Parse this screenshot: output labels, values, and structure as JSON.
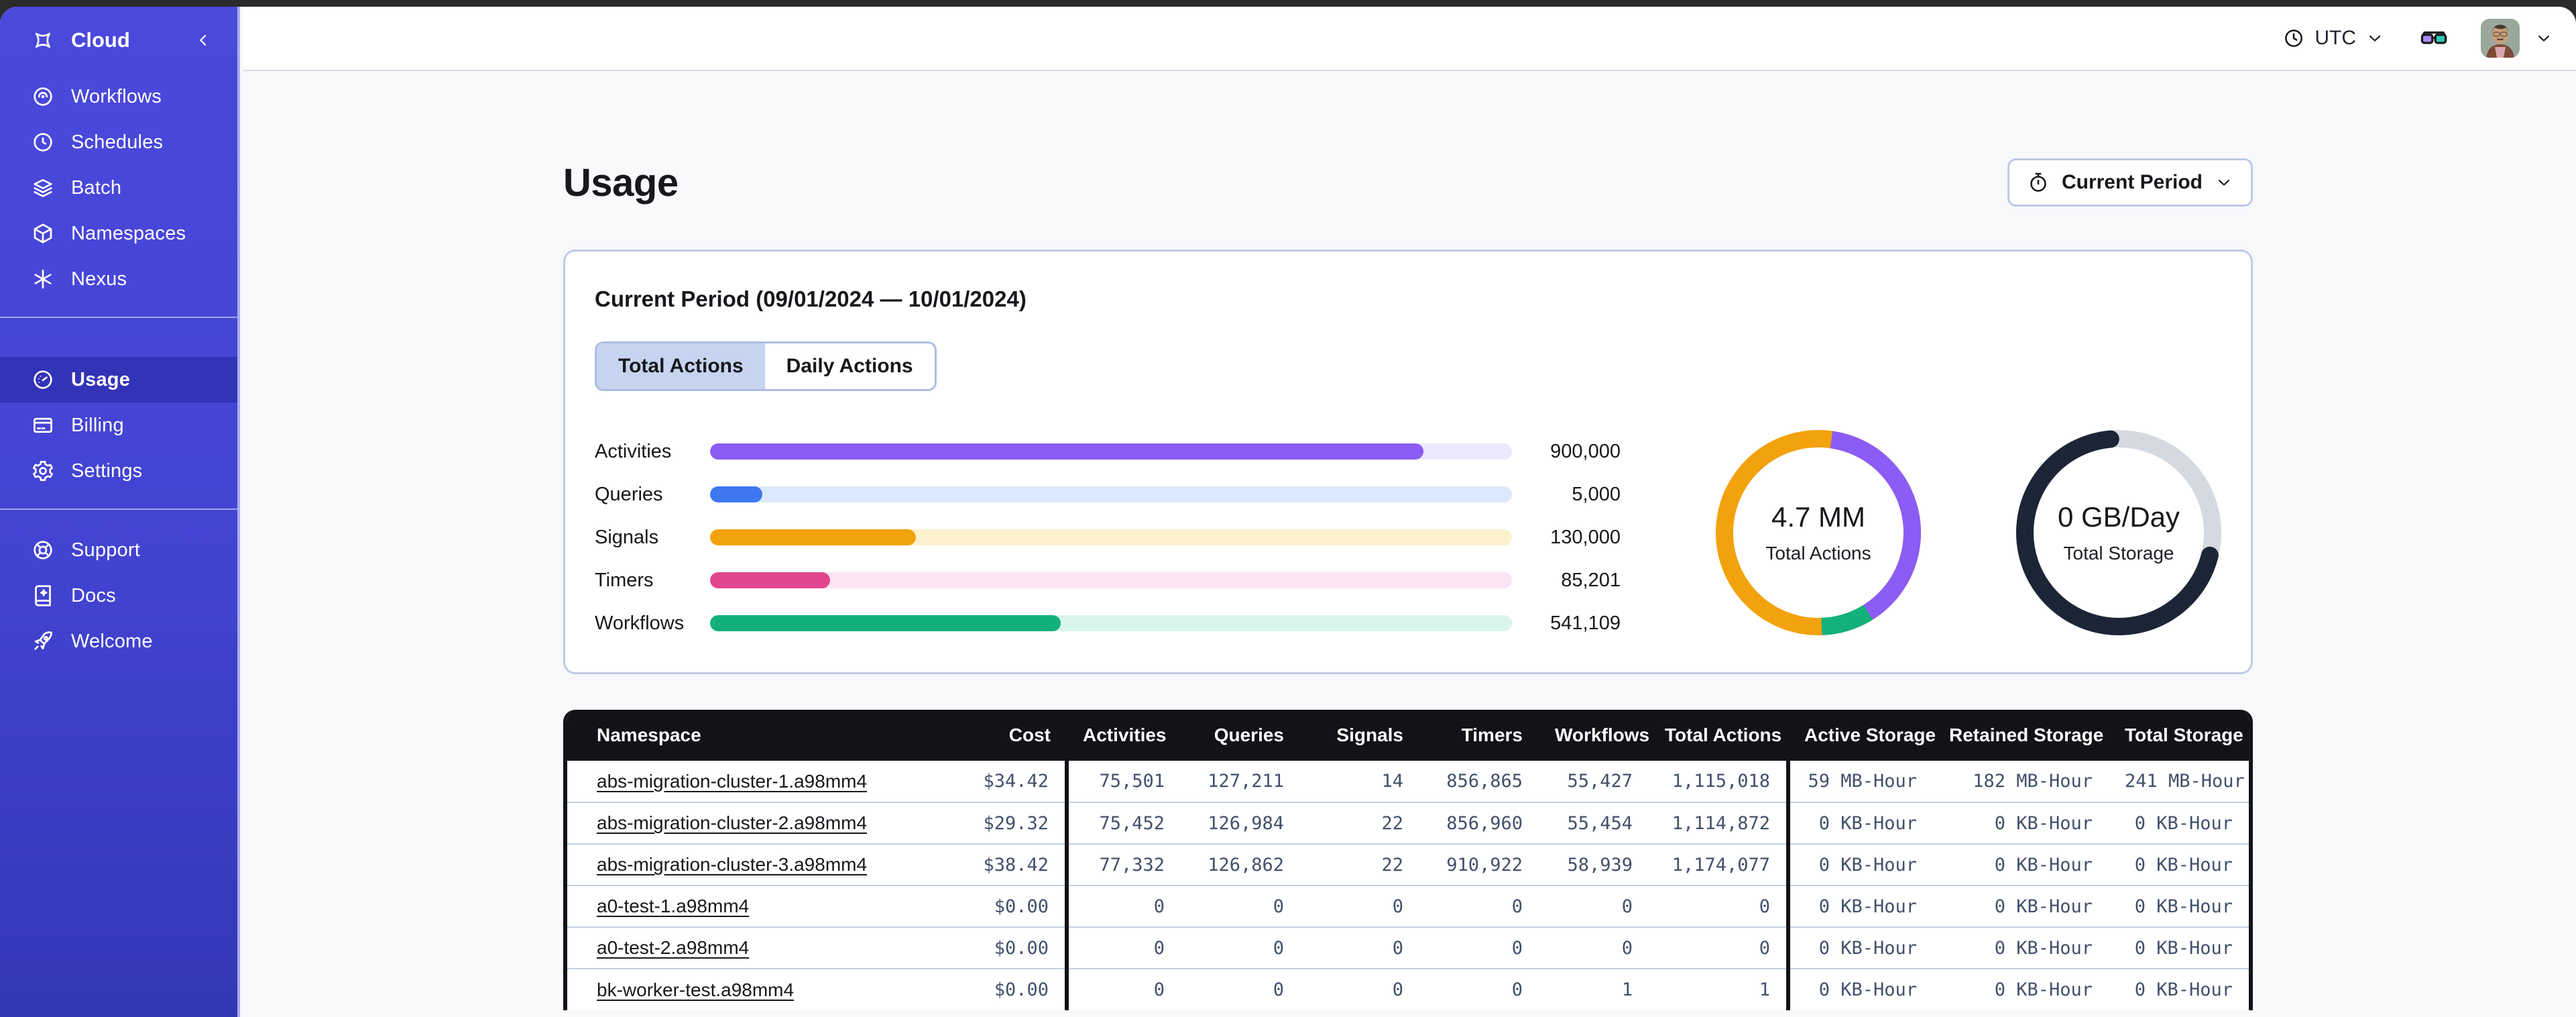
{
  "topbar": {
    "timezone": "UTC"
  },
  "sidebar": {
    "brand": "Cloud",
    "sections": {
      "primary": [
        {
          "label": "Workflows",
          "icon": "workflows-icon"
        },
        {
          "label": "Schedules",
          "icon": "schedules-icon"
        },
        {
          "label": "Batch",
          "icon": "batch-icon"
        },
        {
          "label": "Namespaces",
          "icon": "namespaces-icon"
        },
        {
          "label": "Nexus",
          "icon": "nexus-icon"
        }
      ],
      "account": [
        {
          "label": "Usage",
          "icon": "usage-icon",
          "active": true
        },
        {
          "label": "Billing",
          "icon": "billing-icon"
        },
        {
          "label": "Settings",
          "icon": "settings-icon"
        }
      ],
      "support": [
        {
          "label": "Support",
          "icon": "support-icon"
        },
        {
          "label": "Docs",
          "icon": "docs-icon"
        },
        {
          "label": "Welcome",
          "icon": "welcome-icon"
        }
      ]
    }
  },
  "page": {
    "title": "Usage"
  },
  "period_button": {
    "label": "Current Period"
  },
  "usage_card": {
    "title": "Current Period (09/01/2024 — 10/01/2024)",
    "tabs": [
      {
        "label": "Total Actions",
        "active": true
      },
      {
        "label": "Daily Actions",
        "active": false
      }
    ],
    "bars": [
      {
        "label": "Activities",
        "value": "900,000",
        "pct": 89,
        "color": "#8b5cf6",
        "track": "#ede8fa"
      },
      {
        "label": "Queries",
        "value": "5,000",
        "pct": 6.5,
        "color": "#3d78f2",
        "track": "#dce8fb"
      },
      {
        "label": "Signals",
        "value": "130,000",
        "pct": 25.7,
        "color": "#f2a20d",
        "track": "#fcf1cd"
      },
      {
        "label": "Timers",
        "value": "85,201",
        "pct": 15,
        "color": "#e2458f",
        "track": "#fbe5f4"
      },
      {
        "label": "Workflows",
        "value": "541,109",
        "pct": 43.7,
        "color": "#12b17c",
        "track": "#daf6eb"
      }
    ],
    "donuts": {
      "actions": {
        "value": "4.7 MM",
        "label": "Total Actions",
        "base_color": "#f2a20d",
        "segments": [
          {
            "name": "activities",
            "color": "#8b5cf6",
            "start_deg": 8,
            "sweep_deg": 140
          },
          {
            "name": "workflows",
            "color": "#12b17c",
            "start_deg": 148,
            "sweep_deg": 30
          }
        ]
      },
      "storage": {
        "value": "0 GB/Day",
        "label": "Total Storage",
        "color": "#1b2536",
        "track_color": "#d5d9e0",
        "start_deg": 104,
        "sweep_deg": 251
      }
    }
  },
  "table": {
    "headers": [
      "Namespace",
      "Cost",
      "Activities",
      "Queries",
      "Signals",
      "Timers",
      "Workflows",
      "Total Actions",
      "Active Storage",
      "Retained Storage",
      "Total Storage"
    ],
    "rows": [
      {
        "namespace": "abs-migration-cluster-1.a98mm4",
        "cells": [
          "$34.42",
          "75,501",
          "127,211",
          "14",
          "856,865",
          "55,427",
          "1,115,018",
          "59 MB-Hour",
          "182 MB-Hour",
          "241 MB-Hour"
        ]
      },
      {
        "namespace": "abs-migration-cluster-2.a98mm4",
        "cells": [
          "$29.32",
          "75,452",
          "126,984",
          "22",
          "856,960",
          "55,454",
          "1,114,872",
          "0 KB-Hour",
          "0 KB-Hour",
          "0 KB-Hour"
        ]
      },
      {
        "namespace": "abs-migration-cluster-3.a98mm4",
        "cells": [
          "$38.42",
          "77,332",
          "126,862",
          "22",
          "910,922",
          "58,939",
          "1,174,077",
          "0 KB-Hour",
          "0 KB-Hour",
          "0 KB-Hour"
        ]
      },
      {
        "namespace": "a0-test-1.a98mm4",
        "cells": [
          "$0.00",
          "0",
          "0",
          "0",
          "0",
          "0",
          "0",
          "0 KB-Hour",
          "0 KB-Hour",
          "0 KB-Hour"
        ]
      },
      {
        "namespace": "a0-test-2.a98mm4",
        "cells": [
          "$0.00",
          "0",
          "0",
          "0",
          "0",
          "0",
          "0",
          "0 KB-Hour",
          "0 KB-Hour",
          "0 KB-Hour"
        ]
      },
      {
        "namespace": "bk-worker-test.a98mm4",
        "cells": [
          "$0.00",
          "0",
          "0",
          "0",
          "0",
          "1",
          "1",
          "0 KB-Hour",
          "0 KB-Hour",
          "0 KB-Hour"
        ]
      }
    ]
  }
}
